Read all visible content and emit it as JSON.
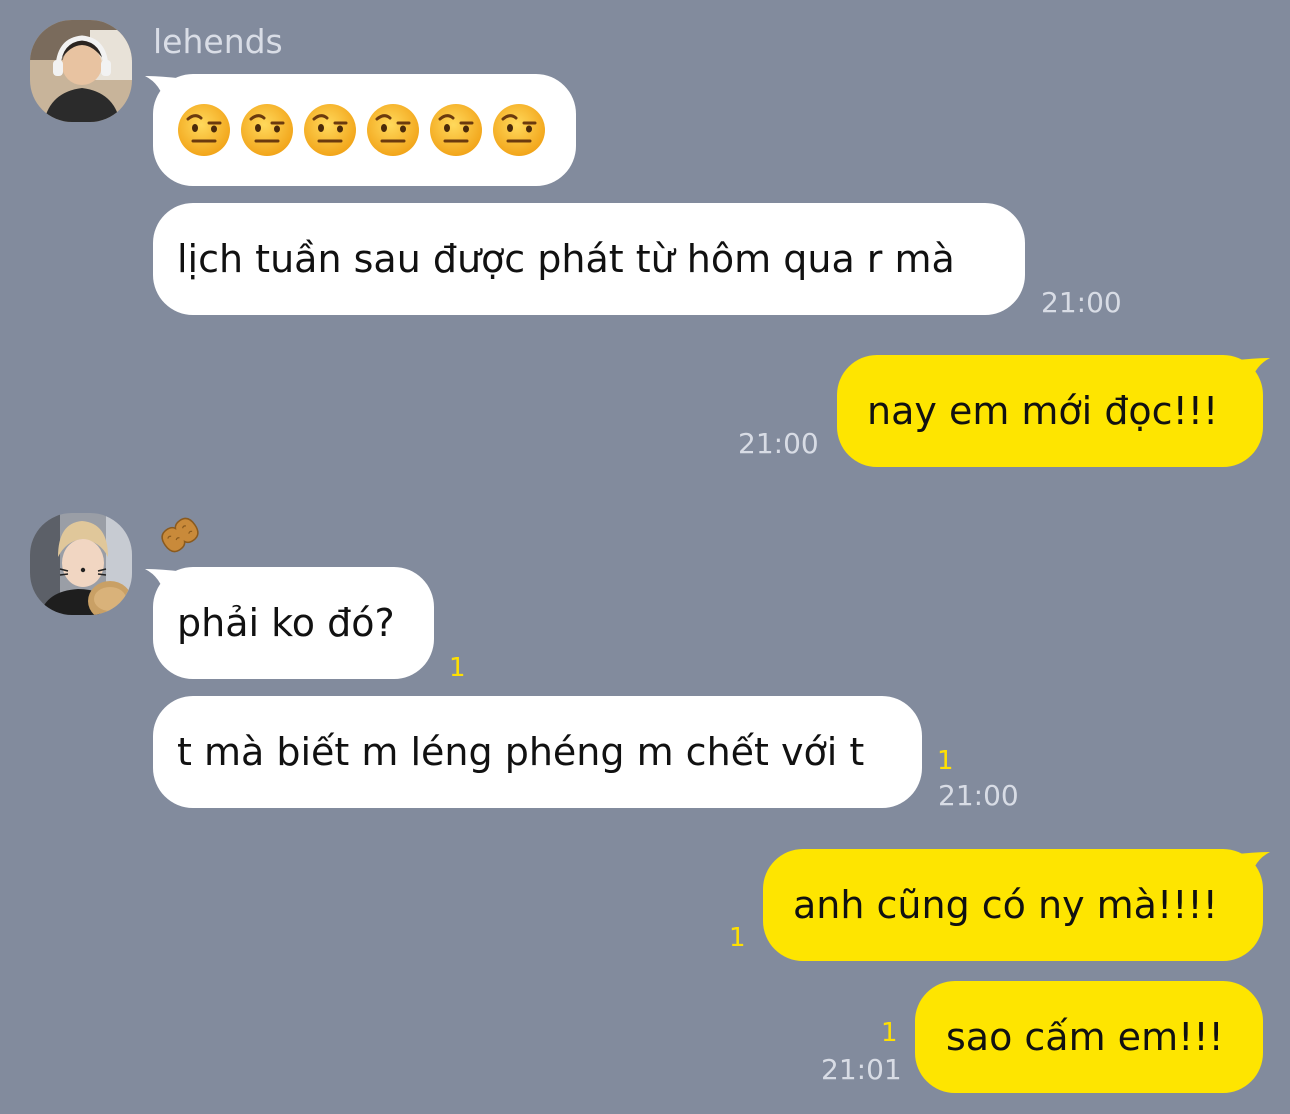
{
  "chat": {
    "sender_1": {
      "name": "lehends",
      "emoji_message": [
        "raised-eyebrow-emoji",
        "raised-eyebrow-emoji",
        "raised-eyebrow-emoji",
        "raised-eyebrow-emoji",
        "raised-eyebrow-emoji",
        "raised-eyebrow-emoji"
      ],
      "message_2": "lịch tuần sau được phát từ hôm qua r mà",
      "time": "21:00"
    },
    "me_1": {
      "message": "nay em mới đọc!!!",
      "time": "21:00"
    },
    "sender_2": {
      "badge_icon": "peanut-icon",
      "message_1": "phải ko đó?",
      "message_1_unread": "1",
      "message_2": "t mà biết m léng phéng m chết với t",
      "message_2_unread": "1",
      "time": "21:00"
    },
    "me_2": {
      "message_1": "anh cũng có ny mà!!!!",
      "message_1_unread": "1",
      "message_2": "sao cấm em!!!",
      "message_2_unread": "1",
      "time": "21:01"
    }
  },
  "colors": {
    "background": "#828b9d",
    "incoming_bubble": "#ffffff",
    "outgoing_bubble": "#fee500",
    "timestamp": "#d8dce5",
    "unread_count": "#ffe000"
  }
}
